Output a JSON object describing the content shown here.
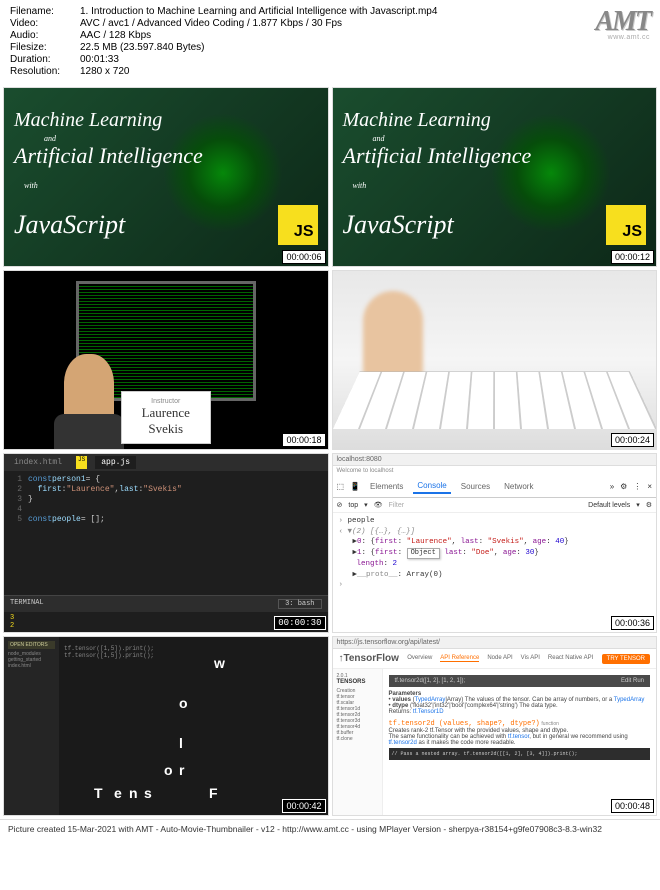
{
  "header": {
    "filename_label": "Filename:",
    "filename": "1. Introduction to Machine Learning and Artificial Intelligence with Javascript.mp4",
    "video_label": "Video:",
    "video": "AVC / avc1 / Advanced Video Coding / 1.877 Kbps / 30 Fps",
    "audio_label": "Audio:",
    "audio": "AAC / 128 Kbps",
    "filesize_label": "Filesize:",
    "filesize": "22.5 MB (23.597.840 Bytes)",
    "duration_label": "Duration:",
    "duration": "00:01:33",
    "resolution_label": "Resolution:",
    "resolution": "1280 x 720",
    "logo": "AMT",
    "logo_sub": "www.amt.cc"
  },
  "course": {
    "line1": "Machine Learning",
    "and": "and",
    "line2": "Artificial Intelligence",
    "with": "with",
    "js": "JavaScript",
    "js_logo": "JS"
  },
  "timestamps": {
    "t1": "00:00:06",
    "t2": "00:00:12",
    "t3": "00:00:18",
    "t4": "00:00:24",
    "t5": "00:00:30",
    "t6": "00:00:36",
    "t7": "00:00:42",
    "t8": "00:00:48"
  },
  "instructor": {
    "label": "Instructor",
    "first": "Laurence",
    "last": "Svekis"
  },
  "code": {
    "tab1": "index.html",
    "tab2": "app.js",
    "tab2_icon": "JS",
    "l1": "const person1 = {",
    "l2_a": "first",
    "l2_b": " : ",
    "l2_c": "\"Laurence\"",
    "l2_d": ", ",
    "l2_e": "last",
    "l2_f": ":",
    "l2_g": "\"Svekis\"",
    "l3": "}",
    "l5": "const people = [];",
    "terminal_label": "TERMINAL",
    "terminal_shell": "3: bash",
    "terminal_out": "3\n2"
  },
  "devtools": {
    "addr": "localhost:8080",
    "tabs": {
      "elements": "Elements",
      "console": "Console",
      "sources": "Sources",
      "network": "Network"
    },
    "toolbar": {
      "top": "top",
      "filter": "Filter",
      "levels": "Default levels"
    },
    "console": {
      "input": "people",
      "array_hdr": "(2) [{…}, {…}]",
      "item0": "0: {first: \"Laurence\", last: \"Svekis\", age: 40}",
      "item1_a": "1: {first:",
      "item1_tooltip": "Object",
      "item1_b": " last: \"Doe\", age: 30}",
      "length": "length: 2",
      "proto": "__proto__: Array(0)"
    }
  },
  "tf_letters": {
    "sidebar_hdr": "OPEN EDITORS",
    "sidebar_items": [
      "node_modules",
      "getting_started",
      "index.html"
    ],
    "code1": "tf.tensor([1,5]).print();",
    "code2": "tf.tensor([1,5]).print();",
    "letters": {
      "T": "T",
      "e": "e",
      "n": "n",
      "s": "s",
      "o1": "o",
      "r": "r",
      "w": "w",
      "o2": "o",
      "l": "l",
      "F": "F"
    }
  },
  "tfdocs": {
    "addr": "https://js.tensorflow.org/api/latest/",
    "logo": "TensorFlow",
    "nav": {
      "overview": "Overview",
      "ref": "API Reference",
      "node": "Node API",
      "vis": "Vis API",
      "rn": "React Native API"
    },
    "cta": "TRY TENSOR",
    "version": "2.0.1",
    "tabbar_l": "tf.tensor2d([1, 2], [1, 2, 1]);",
    "tabbar_r": "Edit   Run",
    "sidebar_hdr": "TENSORS",
    "sidebar_items": [
      "Creation",
      "tf.tensor",
      "tf.scalar",
      "tf.tensor1d",
      "tf.tensor2d",
      "tf.tensor3d",
      "tf.tensor4d",
      "tf.buffer",
      "tf.clone"
    ],
    "section1_label": "Parameters",
    "param1": "values (TypedArray|Array) The values of the tensor. Can be array of numbers, or a TypedArray",
    "param2": "dtype ('float32'|'int32'|'bool'|'complex64'|'string') The data type.",
    "returns": "Returns: tf.Tensor1D",
    "sig": "tf.tensor2d (values, shape?, dtype?)",
    "sig_tag": "function",
    "desc1": "Creates rank-2 tf.Tensor with the provided values, shape and dtype.",
    "desc2": "The same functionality can be achieved with tf.tensor, but in general we recommend using tf.tensor2d as it makes the code more readable.",
    "code_ex": "// Pass a nested array.\ntf.tensor2d([[1, 2], [3, 4]]).print();"
  },
  "footer": "Picture created 15-Mar-2021 with AMT - Auto-Movie-Thumbnailer - v12 - http://www.amt.cc - using MPlayer Version - sherpya-r38154+g9fe07908c3-8.3-win32"
}
